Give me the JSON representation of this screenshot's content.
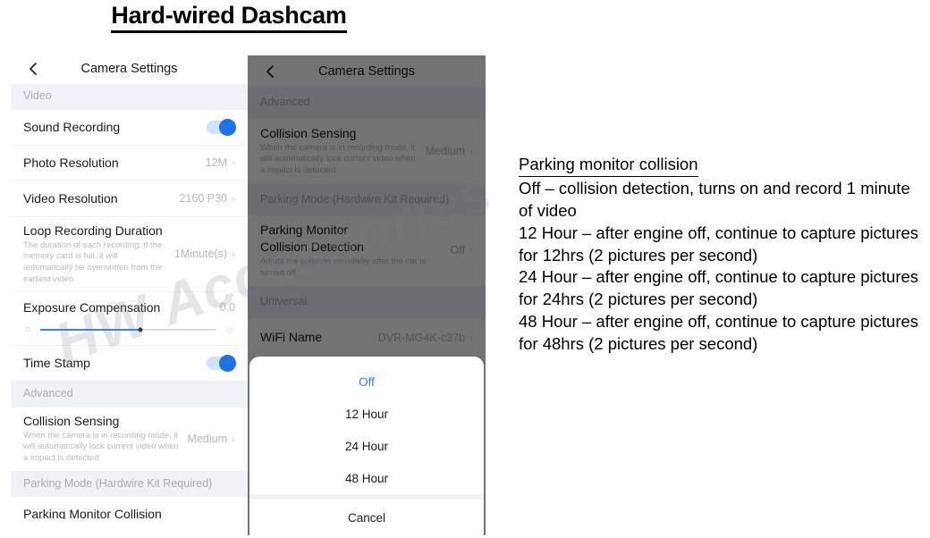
{
  "title": "Hard-wired Dashcam",
  "phone_left": {
    "nav": {
      "back_icon": "chevron-left-icon",
      "title": "Camera Settings"
    },
    "sections": [
      {
        "header": "Video",
        "rows": [
          {
            "title": "Sound Recording",
            "control": "toggle",
            "toggle_on": true
          },
          {
            "title": "Photo Resolution",
            "value": "12M",
            "chevron": "›"
          },
          {
            "title": "Video Resolution",
            "value": "2160 P30",
            "chevron": "›"
          },
          {
            "title": "Loop Recording Duration",
            "subtitle": "The duration of each recording, if the memory card is full, it will automatically be overwritten from the earliest video",
            "value": "1Minute(s)",
            "chevron": "›"
          },
          {
            "title": "Exposure Compensation",
            "value": "0.0",
            "control": "slider",
            "slider_percent": 57
          },
          {
            "title": "Time Stamp",
            "control": "toggle",
            "toggle_on": true
          }
        ]
      },
      {
        "header": "Advanced",
        "rows": [
          {
            "title": "Collision Sensing",
            "subtitle": "When the camera is in recording mode, it will automatically lock current video when a impact is detected",
            "value": "Medium",
            "chevron": "›"
          }
        ]
      },
      {
        "header": "Parking Mode (Hardwire Kit Required)",
        "rows": [
          {
            "title": "Parking Monitor Collision"
          }
        ]
      }
    ]
  },
  "phone_right": {
    "nav": {
      "back_icon": "chevron-left-icon",
      "title": "Camera Settings"
    },
    "sections": [
      {
        "header": "Advanced",
        "rows": [
          {
            "title": "Collision Sensing",
            "subtitle": "When the camera is in recording mode, it will automatically lock current video when a impact is detected",
            "value": "Medium",
            "chevron": "›"
          }
        ]
      },
      {
        "header": "Parking Mode (Hardwire Kit Required)",
        "rows": [
          {
            "title": "Parking Monitor Collision Detection",
            "subtitle": "Adjust the collision sensitivity after the car is turned off",
            "value": "Off",
            "chevron": "›"
          }
        ]
      },
      {
        "header": "Universal",
        "rows": [
          {
            "title": "WiFi Name",
            "value": "DVR-MG4K-c37b",
            "chevron": "›"
          }
        ]
      }
    ],
    "action_sheet": {
      "options": [
        {
          "label": "Off",
          "selected": true
        },
        {
          "label": "12 Hour",
          "selected": false
        },
        {
          "label": "24 Hour",
          "selected": false
        },
        {
          "label": "48 Hour",
          "selected": false
        }
      ],
      "cancel": "Cancel"
    }
  },
  "watermark": "HW Accessories",
  "notes": {
    "heading": "Parking monitor collision",
    "lines": [
      "Off –  collision detection, turns on and record 1 minute of video",
      "12 Hour –  after engine off, continue to capture pictures for 12hrs (2 pictures per second)",
      "24 Hour –  after engine off, continue to capture pictures for 24hrs (2 pictures per second)",
      "48 Hour –  after engine off, continue to capture pictures for 48hrs (2 pictures per second)"
    ]
  },
  "colors": {
    "accent_blue": "#1a73e8",
    "selected_blue": "#2d7ff9",
    "section_bg": "#eff2f7",
    "muted_text": "#b4b8bf"
  }
}
